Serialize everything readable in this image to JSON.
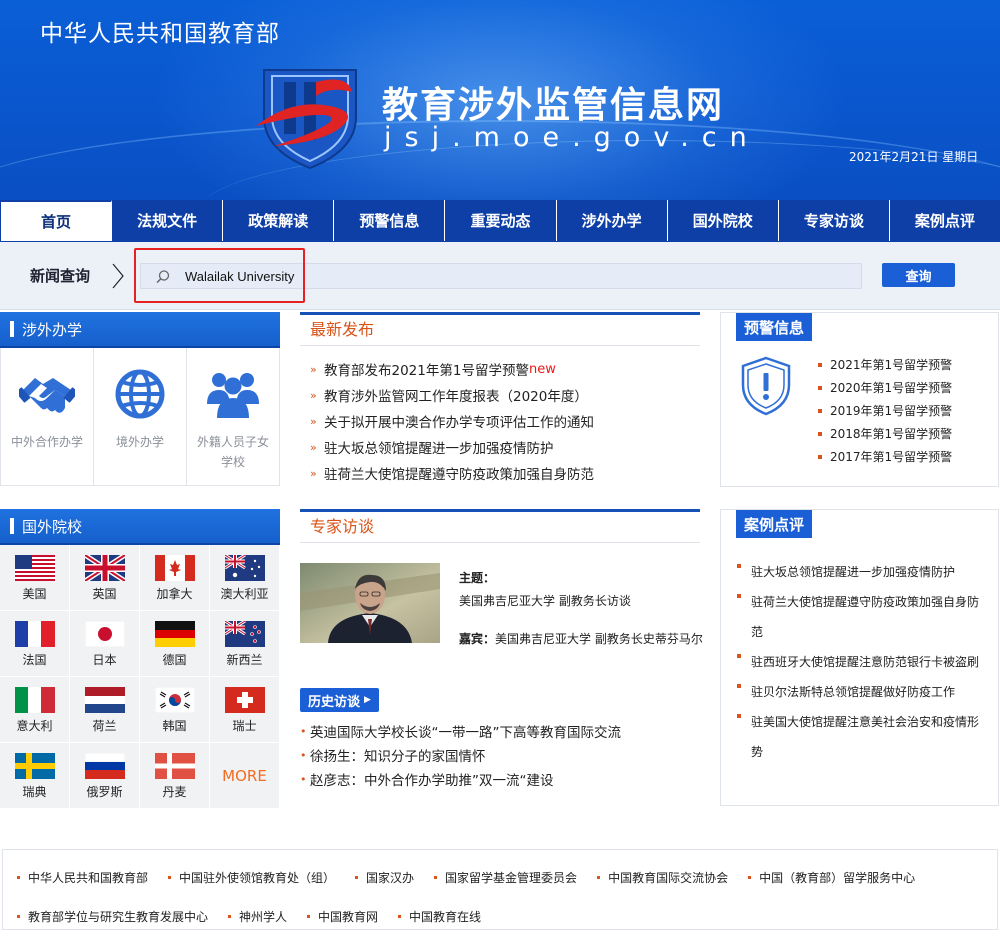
{
  "header": {
    "ministry": "中华人民共和国教育部",
    "site_name": "教育涉外监管信息网",
    "domain": "jsj.moe.gov.cn",
    "date": "2021年2月21日  星期日"
  },
  "nav": {
    "items": [
      {
        "label": "首页"
      },
      {
        "label": "法规文件"
      },
      {
        "label": "政策解读"
      },
      {
        "label": "预警信息"
      },
      {
        "label": "重要动态"
      },
      {
        "label": "涉外办学"
      },
      {
        "label": "国外院校"
      },
      {
        "label": "专家访谈"
      },
      {
        "label": "案例点评"
      }
    ]
  },
  "search": {
    "label": "新闻查询",
    "value": "Walailak University",
    "button": "查询"
  },
  "study_abroad": {
    "title": "涉外办学",
    "items": [
      {
        "label": "中外合作办学",
        "icon": "handshake-icon"
      },
      {
        "label": "境外办学",
        "icon": "globe-icon"
      },
      {
        "label": "外籍人员子女学校",
        "icon": "people-icon"
      }
    ]
  },
  "schools": {
    "title": "国外院校",
    "countries": [
      {
        "name": "美国",
        "flag": "us-flag"
      },
      {
        "name": "英国",
        "flag": "uk-flag"
      },
      {
        "name": "加拿大",
        "flag": "canada-flag"
      },
      {
        "name": "澳大利亚",
        "flag": "australia-flag"
      },
      {
        "name": "法国",
        "flag": "france-flag"
      },
      {
        "name": "日本",
        "flag": "japan-flag"
      },
      {
        "name": "德国",
        "flag": "germany-flag"
      },
      {
        "name": "新西兰",
        "flag": "new-zealand-flag"
      },
      {
        "name": "意大利",
        "flag": "italy-flag"
      },
      {
        "name": "荷兰",
        "flag": "netherlands-flag"
      },
      {
        "name": "韩国",
        "flag": "korea-flag"
      },
      {
        "name": "瑞士",
        "flag": "switzerland-flag"
      },
      {
        "name": "瑞典",
        "flag": "sweden-flag"
      },
      {
        "name": "俄罗斯",
        "flag": "russia-flag"
      },
      {
        "name": "丹麦",
        "flag": "denmark-flag"
      }
    ],
    "more": "MORE"
  },
  "latest": {
    "title": "最新发布",
    "items": [
      {
        "text": "教育部发布2021年第1号留学预警",
        "badge": "new"
      },
      {
        "text": "教育涉外监管网工作年度报表（2020年度）",
        "badge": ""
      },
      {
        "text": "关于拟开展中澳合作办学专项评估工作的通知",
        "badge": ""
      },
      {
        "text": "驻大坂总领馆提醒进一步加强疫情防护",
        "badge": ""
      },
      {
        "text": "驻荷兰大使馆提醒遵守防疫政策加强自身防范",
        "badge": ""
      }
    ]
  },
  "interview": {
    "title": "专家访谈",
    "topic_label": "主题：",
    "topic": "美国弗吉尼亚大学 副教务长访谈",
    "guest_label": "嘉宾：",
    "guest": "美国弗吉尼亚大学 副教务长史蒂芬马尔",
    "history_button": "历史访谈",
    "history": [
      "英迪国际大学校长谈“一带一路”下高等教育国际交流",
      "徐扬生：知识分子的家国情怀",
      "赵彦志：中外合作办学助推”双一流“建设"
    ]
  },
  "warnings": {
    "title": "预警信息",
    "items": [
      "2021年第1号留学预警",
      "2020年第1号留学预警",
      "2019年第1号留学预警",
      "2018年第1号留学预警",
      "2017年第1号留学预警"
    ]
  },
  "cases": {
    "title": "案例点评",
    "items": [
      "驻大坂总领馆提醒进一步加强疫情防护",
      "驻荷兰大使馆提醒遵守防疫政策加强自身防范",
      "驻西班牙大使馆提醒注意防范银行卡被盗刷",
      "驻贝尔法斯特总领馆提醒做好防疫工作",
      "驻美国大使馆提醒注意美社会治安和疫情形势"
    ]
  },
  "footer": {
    "links": [
      "中华人民共和国教育部",
      "中国驻外使领馆教育处（组）",
      "国家汉办",
      "国家留学基金管理委员会",
      "中国教育国际交流协会",
      "中国（教育部）留学服务中心",
      "教育部学位与研究生教育发展中心",
      "神州学人",
      "中国教育网",
      "中国教育在线"
    ]
  },
  "colors": {
    "nav_bg": "#0d3fa6",
    "accent_blue": "#1b5fd6",
    "accent_orange": "#d8541b",
    "highlight_red": "#e52121"
  }
}
